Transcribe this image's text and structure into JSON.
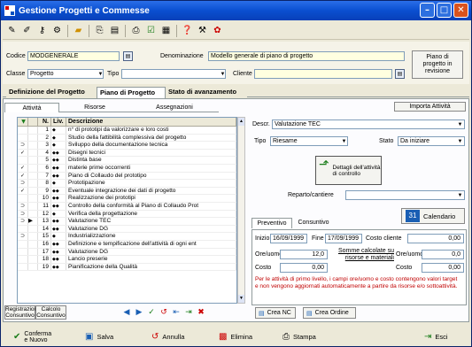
{
  "window": {
    "title": "Gestione Progetti e Commesse",
    "minimize": "–",
    "maximize": "□",
    "close": "✕"
  },
  "toolbar_icons": [
    "edit-icon",
    "pencil-icon",
    "key-icon",
    "wrench-icon",
    "folder-icon",
    "cut-icon",
    "copy-icon",
    "paste-icon",
    "print-icon",
    "checklist-icon",
    "help-icon",
    "tools-icon",
    "extra-icon"
  ],
  "header": {
    "codice_label": "Codice",
    "codice_value": "MODGENERALE",
    "denominazione_label": "Denominazione",
    "denominazione_value": "Modello generale di piano di progetto",
    "classe_label": "Classe",
    "classe_value": "Progetto",
    "tipo_label": "Tipo",
    "tipo_value": "",
    "cliente_label": "Cliente",
    "cliente_value": "",
    "piano_button": "Piano di progetto in revisione"
  },
  "main_tabs": [
    "Definizione del Progetto",
    "Piano di Progetto",
    "Stato di avanzamento"
  ],
  "sub_tabs": [
    "Attività",
    "Risorse",
    "Assegnazioni"
  ],
  "import_button": "Importa Attività",
  "grid": {
    "columns": [
      "",
      "N.",
      "Liv.",
      "Descrizione"
    ],
    "rows": [
      {
        "mark": "",
        "sel": "",
        "n": "1",
        "liv": "◆",
        "desc": "n° di prototipi da valorizzare e loro costi"
      },
      {
        "mark": "",
        "sel": "",
        "n": "2",
        "liv": "◆",
        "desc": "Studio della fattibilità complessiva del progetto"
      },
      {
        "mark": "⊃",
        "sel": "",
        "n": "3",
        "liv": "◆",
        "desc": "Sviluppo della documentazione tecnica"
      },
      {
        "mark": "✓",
        "sel": "",
        "n": "4",
        "liv": "◆◆",
        "desc": "Disegni tecnici"
      },
      {
        "mark": "",
        "sel": "",
        "n": "5",
        "liv": "◆◆",
        "desc": "Distinta base"
      },
      {
        "mark": "✓",
        "sel": "",
        "n": "6",
        "liv": "◆◆",
        "desc": "materie prime occorrenti"
      },
      {
        "mark": "✓",
        "sel": "",
        "n": "7",
        "liv": "◆◆",
        "desc": "Piano di Collaudo del prototipo"
      },
      {
        "mark": "⊃",
        "sel": "",
        "n": "8",
        "liv": "◆",
        "desc": "Prototipazione"
      },
      {
        "mark": "✓",
        "sel": "",
        "n": "9",
        "liv": "◆◆",
        "desc": "Eventuale integrazione dei dati di progetto"
      },
      {
        "mark": "",
        "sel": "",
        "n": "10",
        "liv": "◆◆",
        "desc": "Realizzazione dei prototipi"
      },
      {
        "mark": "⊃",
        "sel": "",
        "n": "11",
        "liv": "◆◆",
        "desc": "Controllo della conformità al Piano di Collaudo Prot"
      },
      {
        "mark": "⊃",
        "sel": "",
        "n": "12",
        "liv": "◆",
        "desc": "Verifica della progettazione"
      },
      {
        "mark": "⊃",
        "sel": "▶",
        "n": "13",
        "liv": "◆◆",
        "desc": "Valutazione TEC"
      },
      {
        "mark": "",
        "sel": "",
        "n": "14",
        "liv": "◆◆",
        "desc": "Valutazione DG"
      },
      {
        "mark": "⊃",
        "sel": "",
        "n": "15",
        "liv": "◆",
        "desc": "Industrializzazione"
      },
      {
        "mark": "",
        "sel": "",
        "n": "16",
        "liv": "◆◆",
        "desc": "Definizione e tempificazione dell'attività di ogni ent"
      },
      {
        "mark": "",
        "sel": "",
        "n": "17",
        "liv": "◆◆",
        "desc": "Valutazione DG"
      },
      {
        "mark": "",
        "sel": "",
        "n": "18",
        "liv": "◆◆",
        "desc": "Lancio preserie"
      },
      {
        "mark": "",
        "sel": "",
        "n": "19",
        "liv": "◆◆",
        "desc": "Pianificazione della Qualità"
      }
    ]
  },
  "registrazione": {
    "left": "Registrazione Consuntivo",
    "right": "Calcolo Consuntivo"
  },
  "right": {
    "descr_label": "Descr.",
    "descr_value": "Valutazione TEC",
    "tipo_label": "Tipo",
    "tipo_value": "Riesame",
    "stato_label": "Stato",
    "stato_value": "Da iniziare",
    "dettagli_button": "Dettagli dell'attività di controllo",
    "reparto_label": "Reparto/cantiere",
    "reparto_value": "",
    "calendario_button": "Calendario",
    "calendar_day": "31",
    "cost_tabs": [
      "Preventivo",
      "Consuntivo"
    ],
    "inizio_label": "Inizio",
    "inizio_value": "16/09/1999",
    "fine_label": "Fine",
    "fine_value": "17/09/1999",
    "costo_cliente_label": "Costo cliente",
    "costo_cliente_value": "0,00",
    "ore_uomo_label": "Ore/uomo",
    "ore_uomo_value": "12,0",
    "somme_label": "Somme calcolate su risorse e materiali",
    "ore_uomo2_label": "Ore/uomo",
    "ore_uomo2_value": "0,0",
    "costo_label": "Costo",
    "costo_value": "0,00",
    "costo2_label": "Costo",
    "costo2_value": "0,00",
    "note": "Per le attività di primo livello, i campi ore/uomo e costo contengono valori target e non vengono aggiornati automaticamente a partire da risorse e/o sottoattività."
  },
  "bottom_buttons": {
    "crea_nc": "Crea NC",
    "crea_ordine": "Crea Ordine"
  },
  "footer": {
    "conferma": "Conferma e Nuovo",
    "salva": "Salva",
    "annulla": "Annulla",
    "elimina": "Elimina",
    "stampa": "Stampa",
    "esci": "Esci"
  },
  "colors": {
    "title_blue": "#0a4fd0",
    "accent_red": "#c00000",
    "yellow_field": "#ffffe0"
  }
}
